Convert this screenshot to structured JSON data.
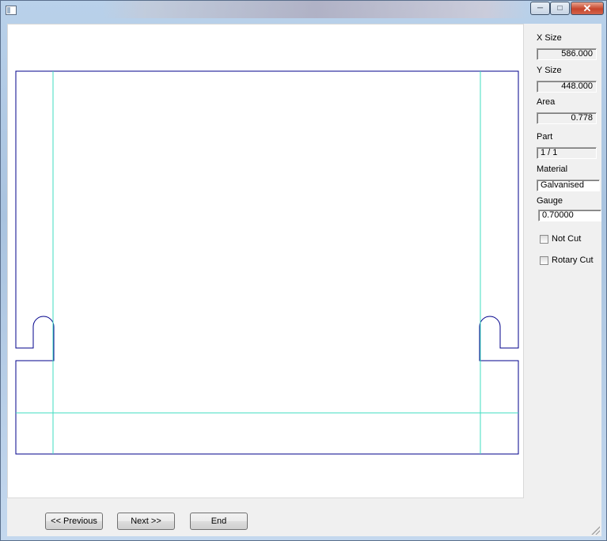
{
  "panel": {
    "x_size_label": "X Size",
    "x_size_value": "586.000",
    "y_size_label": "Y Size",
    "y_size_value": "448.000",
    "area_label": "Area",
    "area_value": "0.778",
    "part_label": "Part",
    "part_value": "1 / 1",
    "material_label": "Material",
    "material_value": "Galvanised",
    "gauge_label": "Gauge",
    "gauge_value": "0.70000",
    "not_cut_label": "Not Cut",
    "not_cut_checked": false,
    "rotary_cut_label": "Rotary Cut",
    "rotary_cut_checked": false
  },
  "buttons": {
    "previous": "<< Previous",
    "next": "Next >>",
    "end": "End"
  },
  "colors": {
    "part_outline": "#00008b",
    "bend_lines": "#3fdcc0",
    "close_button": "#c7452c"
  }
}
